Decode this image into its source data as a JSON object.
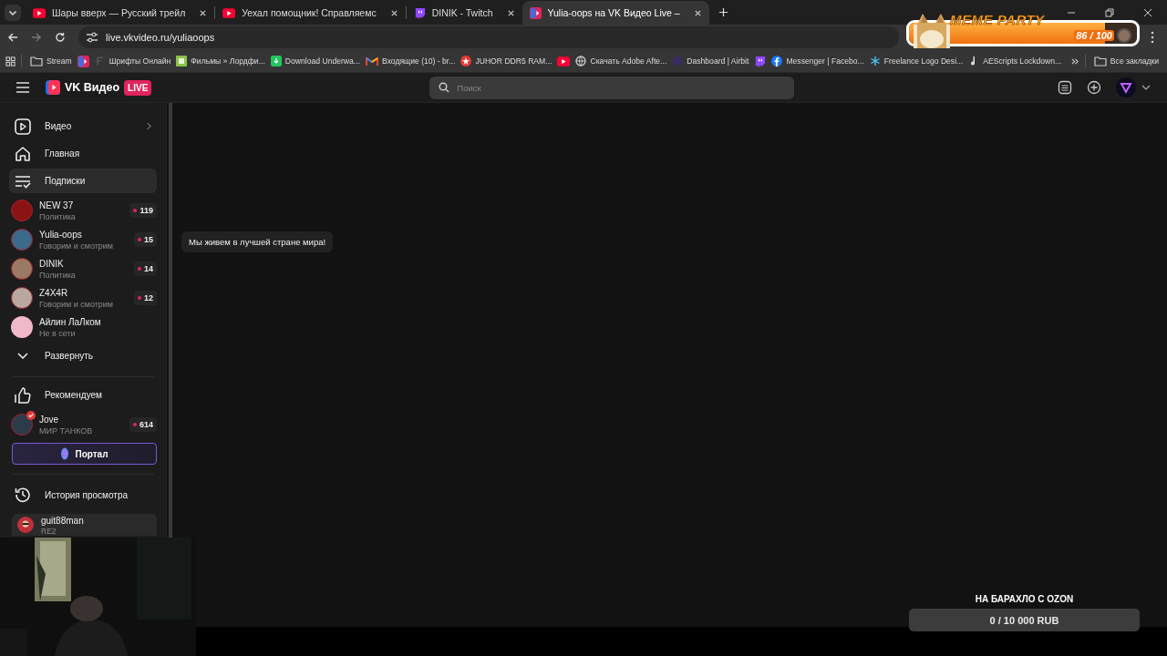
{
  "browser": {
    "tabs": [
      {
        "title": "Шары вверх — Русский трейл",
        "kind": "youtube",
        "selected": false
      },
      {
        "title": "Уехал помощник! Справляемс",
        "kind": "youtube",
        "selected": false
      },
      {
        "title": "DINIK - Twitch",
        "kind": "twitch",
        "selected": false
      },
      {
        "title": "Yulia-oops на VK Видео Live –",
        "kind": "vk",
        "selected": true
      }
    ],
    "url": "live.vkvideo.ru/yuliaoops",
    "bookmarks": [
      {
        "kind": "folder",
        "label": "Stream"
      },
      {
        "kind": "vk"
      },
      {
        "kind": "font",
        "label": "Шрифты Онлайн"
      },
      {
        "kind": "hd",
        "label": "Фильмы » Лордфи..."
      },
      {
        "kind": "ae",
        "label": "Download Underwa..."
      },
      {
        "kind": "mail",
        "label": "Входящие (10) - br..."
      },
      {
        "kind": "star",
        "label": "JUHOR DDR5 RAM..."
      },
      {
        "kind": "youtube"
      },
      {
        "kind": "globe",
        "label": "Скачать Adobe Afte..."
      },
      {
        "kind": "dot",
        "label": "Dashboard | Airbit"
      },
      {
        "kind": "twitch"
      },
      {
        "kind": "facebook",
        "label": "Messenger | Facebo..."
      },
      {
        "kind": "asterisk",
        "label": "Freelance Logo Desi..."
      },
      {
        "kind": "note",
        "label": "AEScripts Lockdown..."
      }
    ],
    "all_bookmarks": "Все закладки"
  },
  "site": {
    "logo": "VK Видео",
    "badge": "LIVE",
    "search": {
      "placeholder": "Поиск"
    }
  },
  "sidebar": {
    "nav": [
      {
        "label": "Видео",
        "kind": "video",
        "selected": false
      },
      {
        "label": "Главная",
        "kind": "home",
        "selected": false
      },
      {
        "label": "Подписки",
        "kind": "subs",
        "selected": true
      }
    ],
    "channels": [
      {
        "name": "NEW 37",
        "subtitle": "Политика",
        "viewers": "119",
        "live": true,
        "color": "#8a1414"
      },
      {
        "name": "Yulia-oops",
        "subtitle": "Говорим и смотрим",
        "viewers": "15",
        "live": true,
        "color": "#3c6a8a"
      },
      {
        "name": "DINIK",
        "subtitle": "Политика",
        "viewers": "14",
        "live": true,
        "color": "#9a7a62"
      },
      {
        "name": "Z4X4R",
        "subtitle": "Говорим и смотрим",
        "viewers": "12",
        "live": true,
        "color": "#b8a8a0"
      },
      {
        "name": "Айлин ЛаЛком",
        "subtitle": "Не в сети",
        "live": false,
        "color": "#f0b8c8"
      }
    ],
    "expand": "Развернуть",
    "recommended": {
      "label": "Рекомендуем",
      "channels": [
        {
          "name": "Jove",
          "subtitle": "МИР ТАНКОВ",
          "viewers": "614",
          "live": true,
          "verified": true,
          "color": "#2c3a4a"
        }
      ]
    },
    "portal": "Портал",
    "history": "История просмотра",
    "account": {
      "name": "guit88man",
      "subtitle": "RE2"
    }
  },
  "tooltip": "Мы живем в лучшей стране мира!",
  "overlays": {
    "meme_party": {
      "title": "MEME PARTY",
      "reading": "86 / 100",
      "level": 0.86
    },
    "goal": {
      "title": "НА БАРАХЛО С OZON",
      "reading": "0 / 10 000 RUB",
      "level": 0
    }
  }
}
